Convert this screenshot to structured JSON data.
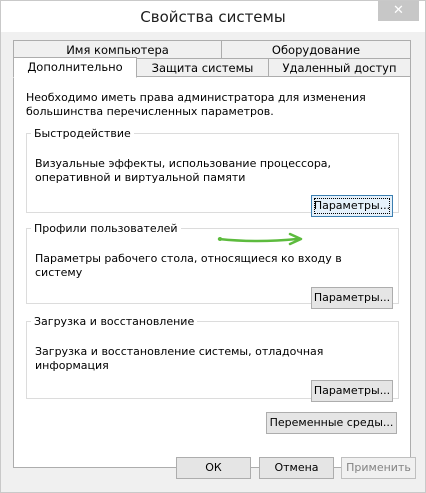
{
  "window": {
    "title": "Свойства системы",
    "close_glyph": "✕"
  },
  "tabs": {
    "row1": [
      {
        "label": "Имя компьютера"
      },
      {
        "label": "Оборудование"
      }
    ],
    "row2": [
      {
        "label": "Дополнительно",
        "active": true
      },
      {
        "label": "Защита системы"
      },
      {
        "label": "Удаленный доступ"
      }
    ]
  },
  "panel": {
    "intro": "Необходимо иметь права администратора для изменения большинства перечисленных параметров.",
    "performance": {
      "title": "Быстродействие",
      "description": "Визуальные эффекты, использование процессора, оперативной и виртуальной памяти",
      "button": "Параметры..."
    },
    "profiles": {
      "title": "Профили пользователей",
      "description": "Параметры рабочего стола, относящиеся ко входу в систему",
      "button": "Параметры..."
    },
    "startup": {
      "title": "Загрузка и восстановление",
      "description": "Загрузка и восстановление системы, отладочная информация",
      "button": "Параметры..."
    },
    "env_button": "Переменные среды..."
  },
  "footer": {
    "ok": "ОК",
    "cancel": "Отмена",
    "apply": "Применить"
  },
  "colors": {
    "arrow": "#5dbb3e",
    "accent_border": "#3c7fb1"
  }
}
